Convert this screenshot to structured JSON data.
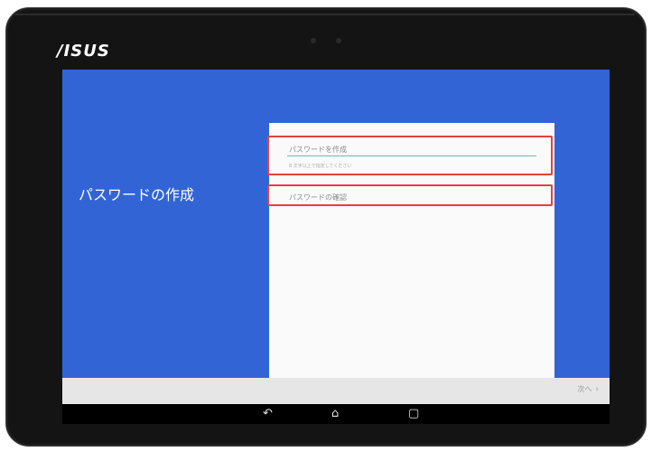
{
  "device": {
    "brand": "/ISUS"
  },
  "screen": {
    "title": "パスワードの作成",
    "password_field": {
      "placeholder": "パスワードを作成",
      "hint": "8 文字以上で指定してください"
    },
    "confirm_field": {
      "placeholder": "パスワードの確認"
    },
    "next_button": {
      "label": "次へ",
      "arrow": "›"
    }
  },
  "navbar": {
    "back_icon": "↶",
    "home_icon": "⌂",
    "recent_icon": "▢"
  },
  "colors": {
    "screen_bg": "#3264d6",
    "highlight": "#e64040",
    "card": "#fafafa"
  }
}
